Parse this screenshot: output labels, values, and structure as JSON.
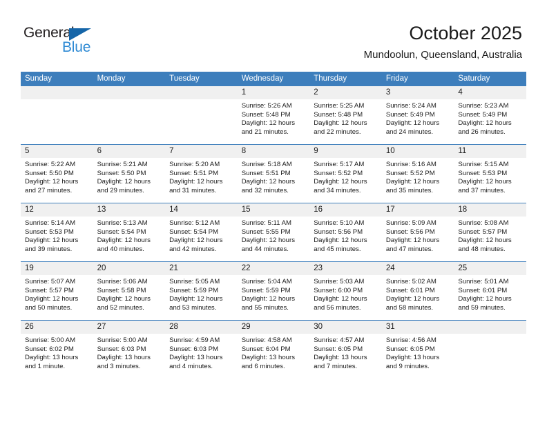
{
  "logo": {
    "word_top": "General",
    "word_bottom": "Blue",
    "triangle_color": "#1565a8",
    "blue_color": "#2e8ad4",
    "dark_color": "#231f20"
  },
  "header": {
    "title": "October 2025",
    "subtitle": "Mundoolun, Queensland, Australia"
  },
  "theme": {
    "accent": "#3d7ebc",
    "daynum_bg": "#f0f0f0",
    "text": "#1a1a1a"
  },
  "calendar": {
    "weekday_headers": [
      "Sunday",
      "Monday",
      "Tuesday",
      "Wednesday",
      "Thursday",
      "Friday",
      "Saturday"
    ],
    "weeks": [
      [
        {
          "day": "",
          "lines": []
        },
        {
          "day": "",
          "lines": []
        },
        {
          "day": "",
          "lines": []
        },
        {
          "day": "1",
          "lines": [
            "Sunrise: 5:26 AM",
            "Sunset: 5:48 PM",
            "Daylight: 12 hours",
            "and 21 minutes."
          ]
        },
        {
          "day": "2",
          "lines": [
            "Sunrise: 5:25 AM",
            "Sunset: 5:48 PM",
            "Daylight: 12 hours",
            "and 22 minutes."
          ]
        },
        {
          "day": "3",
          "lines": [
            "Sunrise: 5:24 AM",
            "Sunset: 5:49 PM",
            "Daylight: 12 hours",
            "and 24 minutes."
          ]
        },
        {
          "day": "4",
          "lines": [
            "Sunrise: 5:23 AM",
            "Sunset: 5:49 PM",
            "Daylight: 12 hours",
            "and 26 minutes."
          ]
        }
      ],
      [
        {
          "day": "5",
          "lines": [
            "Sunrise: 5:22 AM",
            "Sunset: 5:50 PM",
            "Daylight: 12 hours",
            "and 27 minutes."
          ]
        },
        {
          "day": "6",
          "lines": [
            "Sunrise: 5:21 AM",
            "Sunset: 5:50 PM",
            "Daylight: 12 hours",
            "and 29 minutes."
          ]
        },
        {
          "day": "7",
          "lines": [
            "Sunrise: 5:20 AM",
            "Sunset: 5:51 PM",
            "Daylight: 12 hours",
            "and 31 minutes."
          ]
        },
        {
          "day": "8",
          "lines": [
            "Sunrise: 5:18 AM",
            "Sunset: 5:51 PM",
            "Daylight: 12 hours",
            "and 32 minutes."
          ]
        },
        {
          "day": "9",
          "lines": [
            "Sunrise: 5:17 AM",
            "Sunset: 5:52 PM",
            "Daylight: 12 hours",
            "and 34 minutes."
          ]
        },
        {
          "day": "10",
          "lines": [
            "Sunrise: 5:16 AM",
            "Sunset: 5:52 PM",
            "Daylight: 12 hours",
            "and 35 minutes."
          ]
        },
        {
          "day": "11",
          "lines": [
            "Sunrise: 5:15 AM",
            "Sunset: 5:53 PM",
            "Daylight: 12 hours",
            "and 37 minutes."
          ]
        }
      ],
      [
        {
          "day": "12",
          "lines": [
            "Sunrise: 5:14 AM",
            "Sunset: 5:53 PM",
            "Daylight: 12 hours",
            "and 39 minutes."
          ]
        },
        {
          "day": "13",
          "lines": [
            "Sunrise: 5:13 AM",
            "Sunset: 5:54 PM",
            "Daylight: 12 hours",
            "and 40 minutes."
          ]
        },
        {
          "day": "14",
          "lines": [
            "Sunrise: 5:12 AM",
            "Sunset: 5:54 PM",
            "Daylight: 12 hours",
            "and 42 minutes."
          ]
        },
        {
          "day": "15",
          "lines": [
            "Sunrise: 5:11 AM",
            "Sunset: 5:55 PM",
            "Daylight: 12 hours",
            "and 44 minutes."
          ]
        },
        {
          "day": "16",
          "lines": [
            "Sunrise: 5:10 AM",
            "Sunset: 5:56 PM",
            "Daylight: 12 hours",
            "and 45 minutes."
          ]
        },
        {
          "day": "17",
          "lines": [
            "Sunrise: 5:09 AM",
            "Sunset: 5:56 PM",
            "Daylight: 12 hours",
            "and 47 minutes."
          ]
        },
        {
          "day": "18",
          "lines": [
            "Sunrise: 5:08 AM",
            "Sunset: 5:57 PM",
            "Daylight: 12 hours",
            "and 48 minutes."
          ]
        }
      ],
      [
        {
          "day": "19",
          "lines": [
            "Sunrise: 5:07 AM",
            "Sunset: 5:57 PM",
            "Daylight: 12 hours",
            "and 50 minutes."
          ]
        },
        {
          "day": "20",
          "lines": [
            "Sunrise: 5:06 AM",
            "Sunset: 5:58 PM",
            "Daylight: 12 hours",
            "and 52 minutes."
          ]
        },
        {
          "day": "21",
          "lines": [
            "Sunrise: 5:05 AM",
            "Sunset: 5:59 PM",
            "Daylight: 12 hours",
            "and 53 minutes."
          ]
        },
        {
          "day": "22",
          "lines": [
            "Sunrise: 5:04 AM",
            "Sunset: 5:59 PM",
            "Daylight: 12 hours",
            "and 55 minutes."
          ]
        },
        {
          "day": "23",
          "lines": [
            "Sunrise: 5:03 AM",
            "Sunset: 6:00 PM",
            "Daylight: 12 hours",
            "and 56 minutes."
          ]
        },
        {
          "day": "24",
          "lines": [
            "Sunrise: 5:02 AM",
            "Sunset: 6:01 PM",
            "Daylight: 12 hours",
            "and 58 minutes."
          ]
        },
        {
          "day": "25",
          "lines": [
            "Sunrise: 5:01 AM",
            "Sunset: 6:01 PM",
            "Daylight: 12 hours",
            "and 59 minutes."
          ]
        }
      ],
      [
        {
          "day": "26",
          "lines": [
            "Sunrise: 5:00 AM",
            "Sunset: 6:02 PM",
            "Daylight: 13 hours",
            "and 1 minute."
          ]
        },
        {
          "day": "27",
          "lines": [
            "Sunrise: 5:00 AM",
            "Sunset: 6:03 PM",
            "Daylight: 13 hours",
            "and 3 minutes."
          ]
        },
        {
          "day": "28",
          "lines": [
            "Sunrise: 4:59 AM",
            "Sunset: 6:03 PM",
            "Daylight: 13 hours",
            "and 4 minutes."
          ]
        },
        {
          "day": "29",
          "lines": [
            "Sunrise: 4:58 AM",
            "Sunset: 6:04 PM",
            "Daylight: 13 hours",
            "and 6 minutes."
          ]
        },
        {
          "day": "30",
          "lines": [
            "Sunrise: 4:57 AM",
            "Sunset: 6:05 PM",
            "Daylight: 13 hours",
            "and 7 minutes."
          ]
        },
        {
          "day": "31",
          "lines": [
            "Sunrise: 4:56 AM",
            "Sunset: 6:05 PM",
            "Daylight: 13 hours",
            "and 9 minutes."
          ]
        },
        {
          "day": "",
          "lines": []
        }
      ]
    ]
  }
}
